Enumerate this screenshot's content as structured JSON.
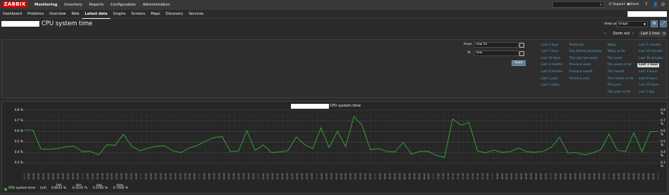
{
  "header": {
    "logo": "ZABBIX",
    "menu": [
      "Monitoring",
      "Inventory",
      "Reports",
      "Configuration",
      "Administration"
    ],
    "active_menu": "Monitoring",
    "support": "Support",
    "share": "Share",
    "help": "?",
    "user": "👤",
    "logout": "⏻",
    "search_icon": "search-icon"
  },
  "submenu": {
    "items": [
      "Dashboard",
      "Problems",
      "Overview",
      "Web",
      "Latest data",
      "Graphs",
      "Screens",
      "Maps",
      "Discovery",
      "Services"
    ],
    "active": "Latest data"
  },
  "page": {
    "title": "CPU system time",
    "view_as_label": "View as",
    "view_as_value": "Graph"
  },
  "timenav": {
    "prev": "‹",
    "zoom_out": "Zoom out",
    "next": "›",
    "active": "Last 1 hour"
  },
  "filter": {
    "from_label": "From",
    "from_value": "now-1h",
    "to_label": "To",
    "to_value": "now",
    "apply": "Apply",
    "quick": [
      [
        "Last 2 days",
        "Last 7 days",
        "Last 30 days",
        "Last 3 months",
        "Last 6 months",
        "Last 1 year",
        "Last 2 years"
      ],
      [
        "Yesterday",
        "Day before yesterday",
        "This day last week",
        "Previous week",
        "Previous month",
        "Previous year"
      ],
      [
        "Today",
        "Today so far",
        "This week",
        "This week so far",
        "This month",
        "This month so far",
        "This year",
        "This year so far"
      ],
      [
        "Last 5 minutes",
        "Last 15 minutes",
        "Last 30 minutes",
        "Last 1 hour",
        "Last 3 hours",
        "Last 6 hours",
        "Last 12 hours",
        "Last 1 day"
      ]
    ],
    "quick_selected": "Last 1 hour"
  },
  "graph": {
    "title": "CPU system time",
    "legend": {
      "name": "CPU system time",
      "agg": "[all]",
      "last_h": "last",
      "last": "0.6014 %",
      "min_h": "min",
      "min": "0.3531 %",
      "avg_h": "avg",
      "avg": "0.4782 %",
      "max_h": "max",
      "max": "0.7406 %"
    },
    "x_labels": [
      "09:43",
      "10:00",
      "10:05",
      "10:10",
      "10:15",
      "10:20",
      "10:25",
      "10:30",
      "10:35",
      "10:40",
      "10:45",
      "10:50",
      "10:55",
      "11:00",
      "11:05",
      "11:10",
      "11:15",
      "11:20",
      "11:25",
      "11:30",
      "11:35",
      "11:40",
      "11:45",
      "11:50",
      "11:55",
      "12:00",
      "12:05",
      "12:10",
      "12:15",
      "12:20",
      "12:25",
      "12:30",
      "12:35",
      "12:40",
      "12:45",
      "12:50",
      "12:55",
      "13:00",
      "13:05",
      "13:10",
      "13:15",
      "13:20",
      "13:25",
      "13:30",
      "13:35",
      "13:40",
      "13:45",
      "13:50",
      "13:55",
      "14:00",
      "14:05",
      "14:10",
      "14:15",
      "14:20",
      "14:25",
      "14:30",
      "14:35",
      "14:40",
      "14:45",
      "14:50",
      "14:55",
      "15:00",
      "15:05",
      "15:10",
      "15:15",
      "15:20",
      "15:25",
      "15:30",
      "15:35",
      "15:40",
      "15:45",
      "15:50",
      "15:55",
      "16:00",
      "16:05",
      "16:10",
      "16:15",
      "16:20",
      "16:25",
      "16:30",
      "16:35",
      "16:40",
      "16:45",
      "16:50",
      "16:55",
      "17:00",
      "17:05",
      "17:10",
      "17:15",
      "17:20",
      "17:25",
      "17:30",
      "17:35",
      "17:40",
      "17:45",
      "17:50",
      "17:55",
      "18:00",
      "18:05",
      "18:10",
      "18:15",
      "18:20",
      "18:25",
      "18:30",
      "18:35",
      "18:40",
      "18:45",
      "18:50",
      "18:55",
      "19:00",
      "19:05",
      "19:10",
      "19:15",
      "19:20",
      "19:25",
      "19:30",
      "19:35",
      "19:40",
      "19:45",
      "19:50",
      "19:55",
      "20:00",
      "20:05",
      "20:10",
      "20:15",
      "20:20",
      "20:25",
      "20:30",
      "20:35",
      "20:40",
      "20:43"
    ],
    "colors": {
      "line": "#2fa32f",
      "grid": "#4a4a4a",
      "red_label": "#d34a4a"
    }
  },
  "chart_data": {
    "type": "line",
    "title": "CPU system time",
    "ylim": [
      0.3,
      0.8
    ],
    "yticks": [
      "0.8 %",
      "0.7 %",
      "0.6 %",
      "0.5 %",
      "0.4 %",
      "0.3 %"
    ],
    "series": [
      {
        "name": "CPU system time",
        "values": [
          0.615,
          0.613,
          0.435,
          0.432,
          0.44,
          0.457,
          0.461,
          0.412,
          0.413,
          0.38,
          0.475,
          0.469,
          0.575,
          0.462,
          0.419,
          0.443,
          0.462,
          0.466,
          0.419,
          0.402,
          0.446,
          0.468,
          0.51,
          0.542,
          0.552,
          0.411,
          0.417,
          0.608,
          0.421,
          0.474,
          0.402,
          0.408,
          0.422,
          0.548,
          0.478,
          0.438,
          0.634,
          0.449,
          0.602,
          0.457,
          0.74,
          0.658,
          0.429,
          0.438,
          0.414,
          0.409,
          0.498,
          0.386,
          0.413,
          0.415,
          0.376,
          0.355,
          0.717,
          0.66,
          0.683,
          0.417,
          0.4,
          0.425,
          0.404,
          0.411,
          0.445,
          0.409,
          0.405,
          0.414,
          0.453,
          0.546,
          0.398,
          0.402,
          0.38,
          0.398,
          0.43,
          0.576,
          0.424,
          0.41,
          0.588,
          0.41,
          0.597,
          0.602
        ]
      }
    ],
    "grid": true,
    "legend": "bottom-left"
  }
}
